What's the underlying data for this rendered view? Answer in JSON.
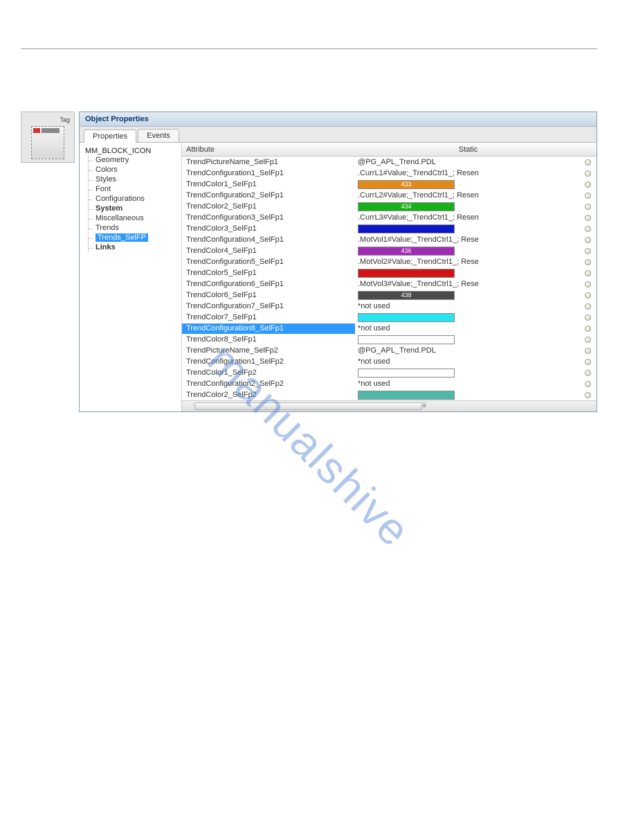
{
  "watermark": "manualshive",
  "iconPanel": {
    "tagLabel": "Tag"
  },
  "panel": {
    "title": "Object Properties",
    "tabs": {
      "properties": "Properties",
      "events": "Events"
    }
  },
  "tree": {
    "root": "MM_BLOCK_ICON",
    "items": [
      {
        "label": "Geometry",
        "bold": false,
        "selected": false
      },
      {
        "label": "Colors",
        "bold": false,
        "selected": false
      },
      {
        "label": "Styles",
        "bold": false,
        "selected": false
      },
      {
        "label": "Font",
        "bold": false,
        "selected": false
      },
      {
        "label": "Configurations",
        "bold": false,
        "selected": false
      },
      {
        "label": "System",
        "bold": true,
        "selected": false
      },
      {
        "label": "Miscellaneous",
        "bold": false,
        "selected": false
      },
      {
        "label": "Trends",
        "bold": false,
        "selected": false
      },
      {
        "label": "Trends_SelFP",
        "bold": false,
        "selected": true
      },
      {
        "label": "Links",
        "bold": true,
        "selected": false
      }
    ]
  },
  "grid": {
    "headers": {
      "attribute": "Attribute",
      "static": "Static"
    },
    "rows": [
      {
        "attr": "TrendPictureName_SelFp1",
        "kind": "text",
        "value": "@PG_APL_Trend.PDL",
        "selected": false
      },
      {
        "attr": "TrendConfiguration1_SelFp1",
        "kind": "text",
        "value": ".CurrL1#Value;_TrendCtrl1_; Resen",
        "selected": false
      },
      {
        "attr": "TrendColor1_SelFp1",
        "kind": "color",
        "color": "#e08a1c",
        "label": "433",
        "selected": false
      },
      {
        "attr": "TrendConfiguration2_SelFp1",
        "kind": "text",
        "value": ".CurrL2#Value;_TrendCtrl1_; Resen",
        "selected": false
      },
      {
        "attr": "TrendColor2_SelFp1",
        "kind": "color",
        "color": "#17b01a",
        "label": "434",
        "selected": false
      },
      {
        "attr": "TrendConfiguration3_SelFp1",
        "kind": "text",
        "value": ".CurrL3#Value;_TrendCtrl1_; Resen",
        "selected": false
      },
      {
        "attr": "TrendColor3_SelFp1",
        "kind": "color",
        "color": "#0b17c9",
        "label": "",
        "selected": false
      },
      {
        "attr": "TrendConfiguration4_SelFp1",
        "kind": "text",
        "value": ".MotVol1#Value;_TrendCtrl1_; Rese",
        "selected": false
      },
      {
        "attr": "TrendColor4_SelFp1",
        "kind": "color",
        "color": "#a22bb6",
        "label": "436",
        "selected": false
      },
      {
        "attr": "TrendConfiguration5_SelFp1",
        "kind": "text",
        "value": ".MotVol2#Value;_TrendCtrl1_; Rese",
        "selected": false
      },
      {
        "attr": "TrendColor5_SelFp1",
        "kind": "color",
        "color": "#d41414",
        "label": "",
        "selected": false
      },
      {
        "attr": "TrendConfiguration6_SelFp1",
        "kind": "text",
        "value": ".MotVol3#Value;_TrendCtrl1_; Rese",
        "selected": false
      },
      {
        "attr": "TrendColor6_SelFp1",
        "kind": "color",
        "color": "#4a4a4a",
        "label": "438",
        "selected": false
      },
      {
        "attr": "TrendConfiguration7_SelFp1",
        "kind": "text",
        "value": "*not used",
        "selected": false
      },
      {
        "attr": "TrendColor7_SelFp1",
        "kind": "color",
        "color": "#2be4f2",
        "label": "",
        "selected": false
      },
      {
        "attr": "TrendConfiguration8_SelFp1",
        "kind": "text",
        "value": "*not used",
        "selected": true
      },
      {
        "attr": "TrendColor8_SelFp1",
        "kind": "color",
        "color": "#ffffff",
        "label": "",
        "selected": false
      },
      {
        "attr": "TrendPictureName_SelFp2",
        "kind": "text",
        "value": "@PG_APL_Trend.PDL",
        "selected": false
      },
      {
        "attr": "TrendConfiguration1_SelFp2",
        "kind": "text",
        "value": "*not used",
        "selected": false
      },
      {
        "attr": "TrendColor1_SelFp2",
        "kind": "color",
        "color": "#ffffff",
        "label": "",
        "selected": false
      },
      {
        "attr": "TrendConfiguration2_SelFp2",
        "kind": "text",
        "value": "*not used",
        "selected": false
      },
      {
        "attr": "TrendColor2_SelFp2",
        "kind": "color",
        "color": "#4fb9a8",
        "label": "",
        "selected": false
      }
    ]
  }
}
